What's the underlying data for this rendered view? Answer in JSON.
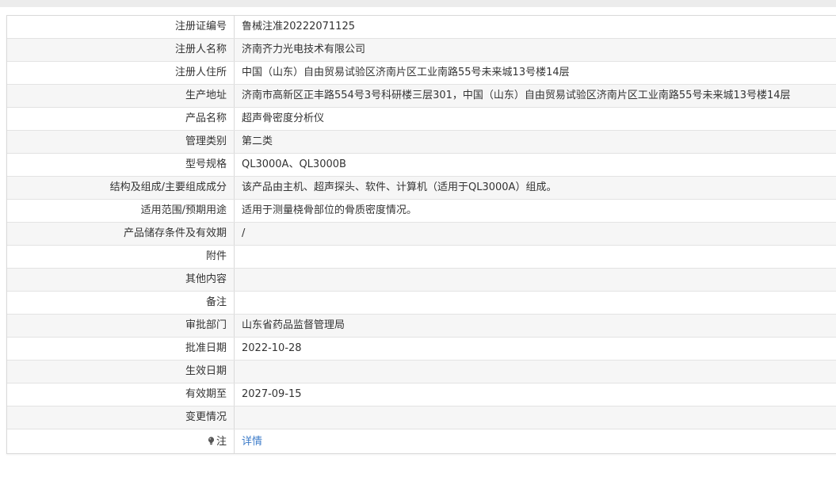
{
  "rows": [
    {
      "label": "注册证编号",
      "value": "鲁械注准20222071125"
    },
    {
      "label": "注册人名称",
      "value": "济南齐力光电技术有限公司"
    },
    {
      "label": "注册人住所",
      "value": "中国（山东）自由贸易试验区济南片区工业南路55号未来城13号楼14层"
    },
    {
      "label": "生产地址",
      "value": "济南市高新区正丰路554号3号科研楼三层301，中国（山东）自由贸易试验区济南片区工业南路55号未来城13号楼14层"
    },
    {
      "label": "产品名称",
      "value": "超声骨密度分析仪"
    },
    {
      "label": "管理类别",
      "value": "第二类"
    },
    {
      "label": "型号规格",
      "value": "QL3000A、QL3000B"
    },
    {
      "label": "结构及组成/主要组成成分",
      "value": "该产品由主机、超声探头、软件、计算机（适用于QL3000A）组成。"
    },
    {
      "label": "适用范围/预期用途",
      "value": "适用于测量桡骨部位的骨质密度情况。"
    },
    {
      "label": "产品储存条件及有效期",
      "value": "/"
    },
    {
      "label": "附件",
      "value": ""
    },
    {
      "label": "其他内容",
      "value": ""
    },
    {
      "label": "备注",
      "value": ""
    },
    {
      "label": "审批部门",
      "value": "山东省药品监督管理局"
    },
    {
      "label": "批准日期",
      "value": "2022-10-28"
    },
    {
      "label": "生效日期",
      "value": ""
    },
    {
      "label": "有效期至",
      "value": "2027-09-15"
    },
    {
      "label": "变更情况",
      "value": ""
    }
  ],
  "note": {
    "label": "注",
    "icon": "lightbulb-icon",
    "link_text": "详情",
    "link_color": "#3d7cc9"
  }
}
